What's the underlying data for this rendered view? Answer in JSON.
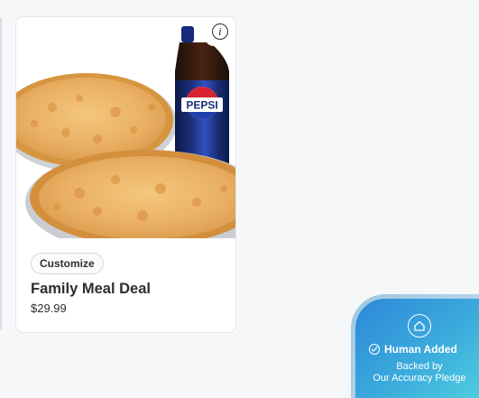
{
  "menu_item": {
    "title": "Family Meal Deal",
    "price": "$29.99",
    "customize_label": "Customize",
    "info_icon": "info-icon",
    "image": {
      "description_icon": "pizza-and-soda-photo",
      "bottle_label": "PEPSI"
    }
  },
  "accuracy_badge": {
    "headline": "Human Added",
    "subtext_line1": "Backed by",
    "subtext_line2": "Our Accuracy Pledge",
    "home_icon": "home-icon",
    "check_icon": "check-circle-icon"
  },
  "colors": {
    "page_background": "#f6f7f9",
    "card_background": "#ffffff",
    "text_primary": "#2b2f33",
    "badge_gradient_start": "#2e88d8",
    "badge_gradient_end": "#52d2e0",
    "pepsi_blue": "#1f3fb0",
    "pepsi_red": "#d92332"
  }
}
